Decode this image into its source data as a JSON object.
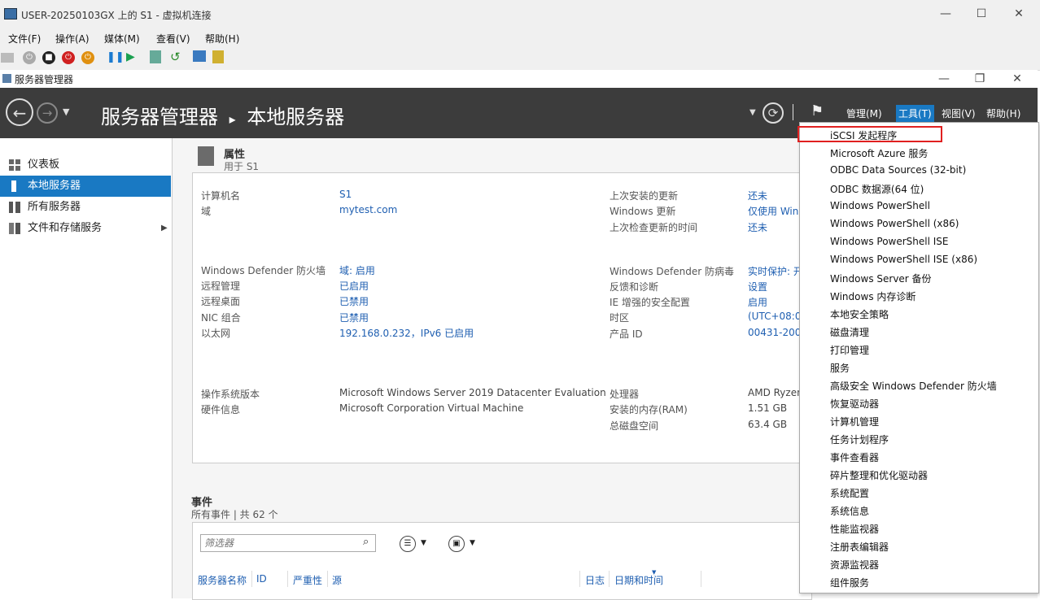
{
  "vm_window": {
    "title": "USER-20250103GX 上的 S1 - 虚拟机连接",
    "menu": [
      "文件(F)",
      "操作(A)",
      "媒体(M)",
      "查看(V)",
      "帮助(H)"
    ]
  },
  "sm_window": {
    "title": "服务器管理器"
  },
  "header": {
    "app_name": "服务器管理器",
    "separator": "▸",
    "page_name": "本地服务器",
    "menus": [
      "管理(M)",
      "工具(T)",
      "视图(V)",
      "帮助(H)"
    ]
  },
  "sidebar": {
    "items": [
      {
        "label": "仪表板"
      },
      {
        "label": "本地服务器"
      },
      {
        "label": "所有服务器"
      },
      {
        "label": "文件和存储服务"
      }
    ]
  },
  "properties": {
    "title": "属性",
    "subtitle": "用于 S1",
    "left_rows": [
      {
        "label": "计算机名",
        "value": "S1"
      },
      {
        "label": "域",
        "value": "mytest.com"
      },
      {
        "label": "Windows Defender 防火墙",
        "value": "域: 启用"
      },
      {
        "label": "远程管理",
        "value": "已启用"
      },
      {
        "label": "远程桌面",
        "value": "已禁用"
      },
      {
        "label": "NIC 组合",
        "value": "已禁用"
      },
      {
        "label": "以太网",
        "value": "192.168.0.232，IPv6 已启用"
      },
      {
        "label": "操作系统版本",
        "value": "Microsoft Windows Server 2019 Datacenter Evaluation"
      },
      {
        "label": "硬件信息",
        "value": "Microsoft Corporation Virtual Machine"
      }
    ],
    "right_rows": [
      {
        "label": "上次安装的更新",
        "value": "还未"
      },
      {
        "label": "Windows 更新",
        "value": "仅使用 Win"
      },
      {
        "label": "上次检查更新的时间",
        "value": "还未"
      },
      {
        "label": "Windows Defender 防病毒",
        "value": "实时保护: 开"
      },
      {
        "label": "反馈和诊断",
        "value": "设置"
      },
      {
        "label": "IE 增强的安全配置",
        "value": "启用"
      },
      {
        "label": "时区",
        "value": "(UTC+08:0"
      },
      {
        "label": "产品 ID",
        "value": "00431-200"
      },
      {
        "label": "处理器",
        "value": "AMD Ryzen"
      },
      {
        "label": "安装的内存(RAM)",
        "value": "1.51 GB"
      },
      {
        "label": "总磁盘空间",
        "value": "63.4 GB"
      }
    ]
  },
  "events": {
    "title": "事件",
    "subtitle": "所有事件 | 共 62 个",
    "filter_placeholder": "筛选器",
    "columns": [
      "服务器名称",
      "ID",
      "严重性",
      "源",
      "日志",
      "日期和时间"
    ]
  },
  "tools_menu": {
    "items": [
      "iSCSI 发起程序",
      "Microsoft Azure 服务",
      "ODBC Data Sources (32-bit)",
      "ODBC 数据源(64 位)",
      "Windows PowerShell",
      "Windows PowerShell (x86)",
      "Windows PowerShell ISE",
      "Windows PowerShell ISE (x86)",
      "Windows Server 备份",
      "Windows 内存诊断",
      "本地安全策略",
      "磁盘清理",
      "打印管理",
      "服务",
      "高级安全 Windows Defender 防火墙",
      "恢复驱动器",
      "计算机管理",
      "任务计划程序",
      "事件查看器",
      "碎片整理和优化驱动器",
      "系统配置",
      "系统信息",
      "性能监视器",
      "注册表编辑器",
      "资源监视器",
      "组件服务"
    ]
  }
}
